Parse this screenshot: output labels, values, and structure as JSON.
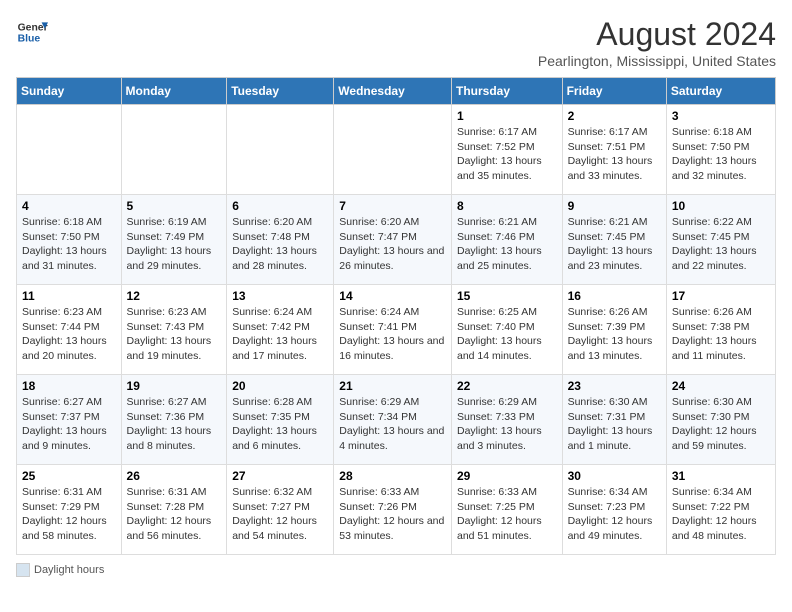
{
  "header": {
    "logo_line1": "General",
    "logo_line2": "Blue",
    "title": "August 2024",
    "subtitle": "Pearlington, Mississippi, United States"
  },
  "days_of_week": [
    "Sunday",
    "Monday",
    "Tuesday",
    "Wednesday",
    "Thursday",
    "Friday",
    "Saturday"
  ],
  "weeks": [
    [
      {
        "day": "",
        "info": ""
      },
      {
        "day": "",
        "info": ""
      },
      {
        "day": "",
        "info": ""
      },
      {
        "day": "",
        "info": ""
      },
      {
        "day": "1",
        "info": "Sunrise: 6:17 AM\nSunset: 7:52 PM\nDaylight: 13 hours and 35 minutes."
      },
      {
        "day": "2",
        "info": "Sunrise: 6:17 AM\nSunset: 7:51 PM\nDaylight: 13 hours and 33 minutes."
      },
      {
        "day": "3",
        "info": "Sunrise: 6:18 AM\nSunset: 7:50 PM\nDaylight: 13 hours and 32 minutes."
      }
    ],
    [
      {
        "day": "4",
        "info": "Sunrise: 6:18 AM\nSunset: 7:50 PM\nDaylight: 13 hours and 31 minutes."
      },
      {
        "day": "5",
        "info": "Sunrise: 6:19 AM\nSunset: 7:49 PM\nDaylight: 13 hours and 29 minutes."
      },
      {
        "day": "6",
        "info": "Sunrise: 6:20 AM\nSunset: 7:48 PM\nDaylight: 13 hours and 28 minutes."
      },
      {
        "day": "7",
        "info": "Sunrise: 6:20 AM\nSunset: 7:47 PM\nDaylight: 13 hours and 26 minutes."
      },
      {
        "day": "8",
        "info": "Sunrise: 6:21 AM\nSunset: 7:46 PM\nDaylight: 13 hours and 25 minutes."
      },
      {
        "day": "9",
        "info": "Sunrise: 6:21 AM\nSunset: 7:45 PM\nDaylight: 13 hours and 23 minutes."
      },
      {
        "day": "10",
        "info": "Sunrise: 6:22 AM\nSunset: 7:45 PM\nDaylight: 13 hours and 22 minutes."
      }
    ],
    [
      {
        "day": "11",
        "info": "Sunrise: 6:23 AM\nSunset: 7:44 PM\nDaylight: 13 hours and 20 minutes."
      },
      {
        "day": "12",
        "info": "Sunrise: 6:23 AM\nSunset: 7:43 PM\nDaylight: 13 hours and 19 minutes."
      },
      {
        "day": "13",
        "info": "Sunrise: 6:24 AM\nSunset: 7:42 PM\nDaylight: 13 hours and 17 minutes."
      },
      {
        "day": "14",
        "info": "Sunrise: 6:24 AM\nSunset: 7:41 PM\nDaylight: 13 hours and 16 minutes."
      },
      {
        "day": "15",
        "info": "Sunrise: 6:25 AM\nSunset: 7:40 PM\nDaylight: 13 hours and 14 minutes."
      },
      {
        "day": "16",
        "info": "Sunrise: 6:26 AM\nSunset: 7:39 PM\nDaylight: 13 hours and 13 minutes."
      },
      {
        "day": "17",
        "info": "Sunrise: 6:26 AM\nSunset: 7:38 PM\nDaylight: 13 hours and 11 minutes."
      }
    ],
    [
      {
        "day": "18",
        "info": "Sunrise: 6:27 AM\nSunset: 7:37 PM\nDaylight: 13 hours and 9 minutes."
      },
      {
        "day": "19",
        "info": "Sunrise: 6:27 AM\nSunset: 7:36 PM\nDaylight: 13 hours and 8 minutes."
      },
      {
        "day": "20",
        "info": "Sunrise: 6:28 AM\nSunset: 7:35 PM\nDaylight: 13 hours and 6 minutes."
      },
      {
        "day": "21",
        "info": "Sunrise: 6:29 AM\nSunset: 7:34 PM\nDaylight: 13 hours and 4 minutes."
      },
      {
        "day": "22",
        "info": "Sunrise: 6:29 AM\nSunset: 7:33 PM\nDaylight: 13 hours and 3 minutes."
      },
      {
        "day": "23",
        "info": "Sunrise: 6:30 AM\nSunset: 7:31 PM\nDaylight: 13 hours and 1 minute."
      },
      {
        "day": "24",
        "info": "Sunrise: 6:30 AM\nSunset: 7:30 PM\nDaylight: 12 hours and 59 minutes."
      }
    ],
    [
      {
        "day": "25",
        "info": "Sunrise: 6:31 AM\nSunset: 7:29 PM\nDaylight: 12 hours and 58 minutes."
      },
      {
        "day": "26",
        "info": "Sunrise: 6:31 AM\nSunset: 7:28 PM\nDaylight: 12 hours and 56 minutes."
      },
      {
        "day": "27",
        "info": "Sunrise: 6:32 AM\nSunset: 7:27 PM\nDaylight: 12 hours and 54 minutes."
      },
      {
        "day": "28",
        "info": "Sunrise: 6:33 AM\nSunset: 7:26 PM\nDaylight: 12 hours and 53 minutes."
      },
      {
        "day": "29",
        "info": "Sunrise: 6:33 AM\nSunset: 7:25 PM\nDaylight: 12 hours and 51 minutes."
      },
      {
        "day": "30",
        "info": "Sunrise: 6:34 AM\nSunset: 7:23 PM\nDaylight: 12 hours and 49 minutes."
      },
      {
        "day": "31",
        "info": "Sunrise: 6:34 AM\nSunset: 7:22 PM\nDaylight: 12 hours and 48 minutes."
      }
    ]
  ],
  "footer": {
    "legend_label": "Daylight hours"
  }
}
